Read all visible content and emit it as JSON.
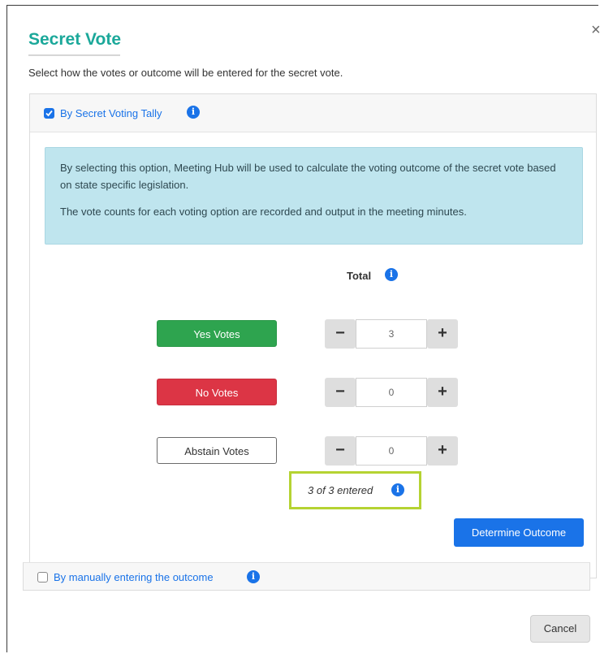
{
  "modal": {
    "title": "Secret Vote",
    "close": "×",
    "subtitle": "Select how the votes or outcome will be entered for the secret vote."
  },
  "option_tally": {
    "label": "By Secret Voting Tally",
    "checked": true
  },
  "info_text": {
    "line1": "By selecting this option, Meeting Hub will be used to calculate the voting outcome of the secret vote based on state specific legislation.",
    "line2": "The vote counts for each voting option are recorded and output in the meeting minutes."
  },
  "tally": {
    "total_label": "Total",
    "rows": [
      {
        "label": "Yes Votes",
        "value": "3",
        "minus": "−",
        "plus": "+"
      },
      {
        "label": "No Votes",
        "value": "0",
        "minus": "−",
        "plus": "+"
      },
      {
        "label": "Abstain Votes",
        "value": "0",
        "minus": "−",
        "plus": "+"
      }
    ],
    "entered": "3 of 3 entered"
  },
  "buttons": {
    "determine": "Determine Outcome",
    "cancel": "Cancel"
  },
  "option_manual": {
    "label": "By manually entering the outcome",
    "checked": false
  },
  "icons": {
    "info": "i"
  },
  "colors": {
    "accent": "#1a73e8",
    "title": "#1ba89a",
    "yes": "#2ea44f",
    "no": "#dc3545",
    "highlight": "#b5d332",
    "alert_bg": "#bfe5ee"
  }
}
